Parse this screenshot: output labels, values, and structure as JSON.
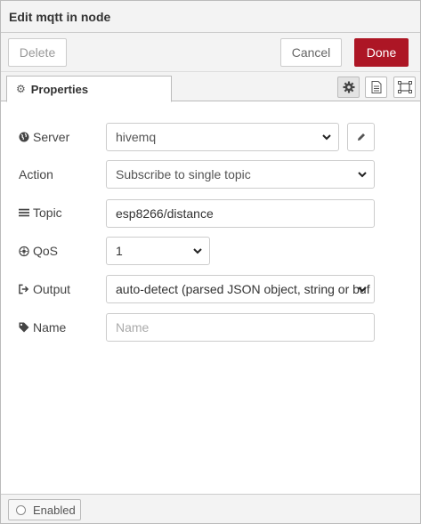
{
  "tray": {
    "title": "Edit mqtt in node"
  },
  "toolbar": {
    "delete_label": "Delete",
    "cancel_label": "Cancel",
    "done_label": "Done"
  },
  "tabs": {
    "properties_label": "Properties",
    "icons": [
      "gear-icon",
      "description-icon",
      "appearance-icon"
    ]
  },
  "form": {
    "server": {
      "label": "Server",
      "value": "hivemq",
      "icon": "globe-icon"
    },
    "action": {
      "label": "Action",
      "value": "Subscribe to single topic"
    },
    "topic": {
      "label": "Topic",
      "value": "esp8266/distance",
      "icon": "tasks-icon"
    },
    "qos": {
      "label": "QoS",
      "value": "1",
      "icon": "qos-icon"
    },
    "output": {
      "label": "Output",
      "value": "auto-detect (parsed JSON object, string or buf",
      "icon": "sign-out-icon"
    },
    "name": {
      "label": "Name",
      "value": "",
      "placeholder": "Name",
      "icon": "tag-icon"
    }
  },
  "footer": {
    "enabled_label": "Enabled"
  },
  "colors": {
    "done_bg": "#ad1625",
    "panel_bg": "#f3f3f3"
  }
}
